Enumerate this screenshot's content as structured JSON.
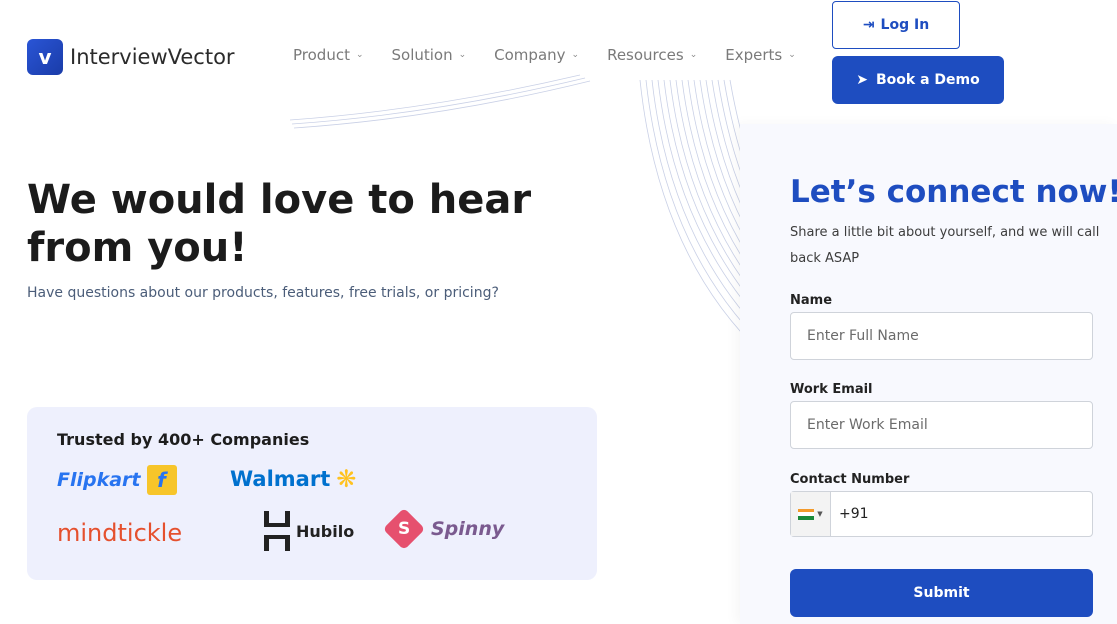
{
  "brand": {
    "name": "InterviewVector",
    "logo_glyph": "v"
  },
  "nav": {
    "items": [
      {
        "label": "Product"
      },
      {
        "label": "Solution"
      },
      {
        "label": "Company"
      },
      {
        "label": "Resources"
      },
      {
        "label": "Experts"
      }
    ],
    "chevron_icon": "chevron-down-icon"
  },
  "header_actions": {
    "login_label": "Log In",
    "login_icon": "login-arrow-icon",
    "demo_label": "Book a Demo",
    "demo_icon": "send-icon"
  },
  "hero": {
    "title": "We would love to hear from you!",
    "subtitle": "Have questions about our products, features, free trials, or pricing?"
  },
  "trusted": {
    "title": "Trusted by 400+ Companies",
    "logos": [
      "Flipkart",
      "Walmart",
      "mindtickle",
      "Hubilo",
      "Spinny"
    ]
  },
  "form": {
    "title": "Let’s connect now!",
    "subtitle": "Share a little bit about yourself, and we will call back ASAP",
    "name_label": "Name",
    "name_placeholder": "Enter Full Name",
    "email_label": "Work Email",
    "email_placeholder": "Enter Work Email",
    "phone_label": "Contact Number",
    "phone_value": "+91",
    "country_flag": "India",
    "submit_label": "Submit"
  },
  "colors": {
    "brand_blue": "#1e4dc0",
    "trusted_bg": "#eef0fd",
    "form_bg": "#f8f9fe"
  }
}
